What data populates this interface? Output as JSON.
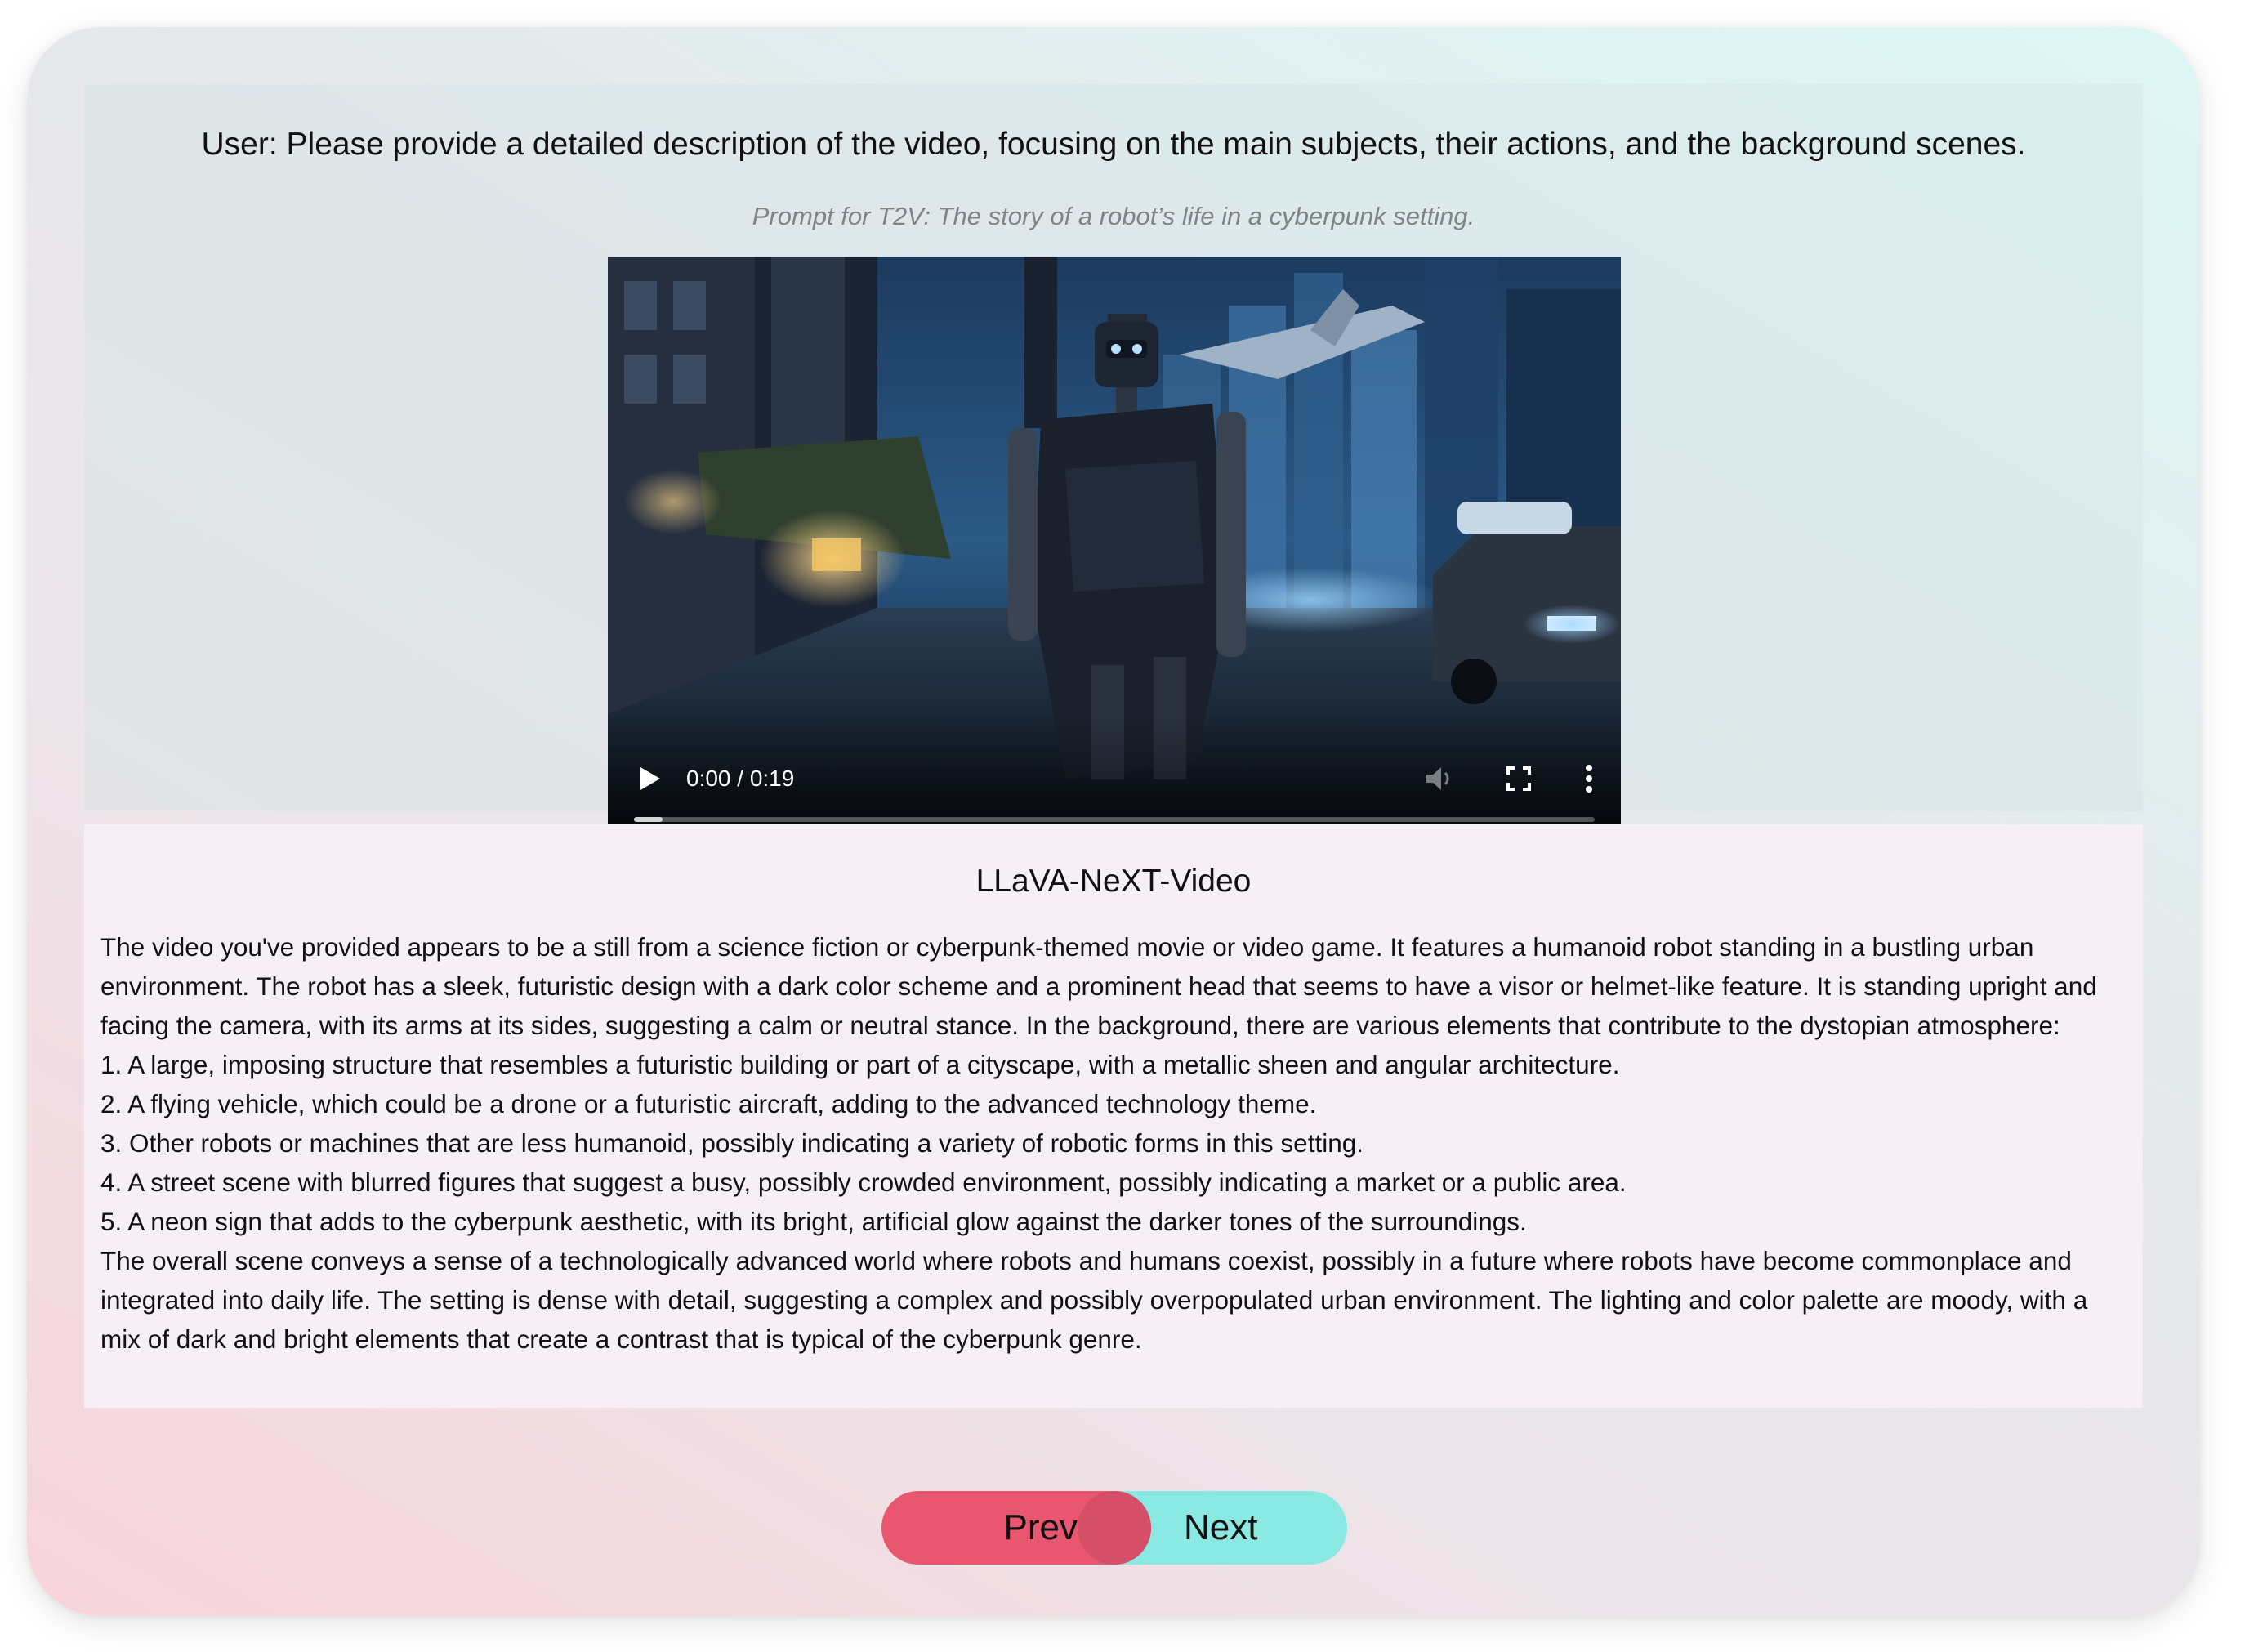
{
  "prompt": {
    "user_question": "User: Please provide a detailed description of the video, focusing on the main subjects, their actions, and the background scenes.",
    "t2v_prompt": "Prompt for T2V: The story of a robot’s life in a cyberpunk setting."
  },
  "video": {
    "time": "0:00 / 0:19",
    "progress": 0.03,
    "controls": [
      "play-icon",
      "volume-muted-icon",
      "fullscreen-icon",
      "more-options-icon"
    ]
  },
  "answer": {
    "model": "LLaVA-NeXT-Video",
    "paragraphs": [
      "The video you've provided appears to be a still from a science fiction or cyberpunk-themed movie or video game. It features a humanoid robot standing in a bustling urban environment. The robot has a sleek, futuristic design with a dark color scheme and a prominent head that seems to have a visor or helmet-like feature. It is standing upright and facing the camera, with its arms at its sides, suggesting a calm or neutral stance. In the background, there are various elements that contribute to the dystopian atmosphere:",
      "1. A large, imposing structure that resembles a futuristic building or part of a cityscape, with a metallic sheen and angular architecture.",
      "2. A flying vehicle, which could be a drone or a futuristic aircraft, adding to the advanced technology theme.",
      "3. Other robots or machines that are less humanoid, possibly indicating a variety of robotic forms in this setting.",
      "4. A street scene with blurred figures that suggest a busy, possibly crowded environment, possibly indicating a market or a public area.",
      "5. A neon sign that adds to the cyberpunk aesthetic, with its bright, artificial glow against the darker tones of the surroundings.",
      "The overall scene conveys a sense of a technologically advanced world where robots and humans coexist, possibly in a future where robots have become commonplace and integrated into daily life. The setting is dense with detail, suggesting a complex and possibly overpopulated urban environment. The lighting and color palette are moody, with a mix of dark and bright elements that create a contrast that is typical of the cyberpunk genre."
    ]
  },
  "nav": {
    "prev_label": "Prev",
    "next_label": "Next"
  },
  "colors": {
    "prev": "#e9566f",
    "next": "#8ae9e3",
    "answer_panel": "#f6eff5"
  }
}
